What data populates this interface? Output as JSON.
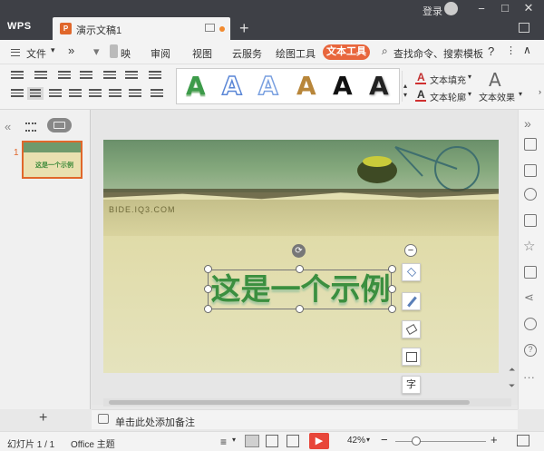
{
  "app": {
    "logo": "WPS",
    "doc_tab": "演示文稿1",
    "login": "登录"
  },
  "menubar": {
    "file": "文件",
    "more": "»",
    "partial": "映",
    "tabs": [
      "审阅",
      "视图",
      "云服务",
      "绘图工具"
    ],
    "active_tab": "文本工具",
    "search": "查找命令、搜索模板",
    "help": "?"
  },
  "toolbar": {
    "fill": "文本填充",
    "outline": "文本轮廓",
    "effect": "文本效果",
    "styles": [
      "#3d9b4a",
      "#5a86d6",
      "#7aa0e0",
      "#b8863a",
      "#111111",
      "#222222"
    ]
  },
  "slidepane": {
    "number": "1",
    "thumb_text": "这是一个示例"
  },
  "slide": {
    "title": "这是一个示例",
    "watermark": "BIDE.IQ3.COM"
  },
  "floatbar": {
    "minus": "−",
    "text_btn": "字"
  },
  "notes": {
    "placeholder": "单击此处添加备注"
  },
  "statusbar": {
    "slide_info": "幻灯片 1 / 1",
    "theme": "Office 主题",
    "zoom": "42%"
  },
  "colors": {
    "accent": "#e8663d",
    "titlebar": "#3e4046"
  }
}
